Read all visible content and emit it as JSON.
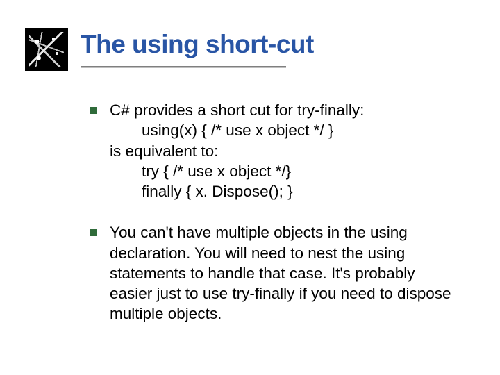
{
  "title": "The using short-cut",
  "bullets": [
    {
      "line1": "C# provides a short cut for try-finally:",
      "line2": "using(x) { /* use x object */ }",
      "line3": "is equivalent to:",
      "line4": "try { /* use x object */}",
      "line5": "finally { x. Dispose(); }"
    },
    {
      "text": "You can't have multiple objects in the using declaration.  You will need to nest the using statements to handle that case.  It's probably easier just to use try-finally if you need to dispose multiple objects."
    }
  ]
}
